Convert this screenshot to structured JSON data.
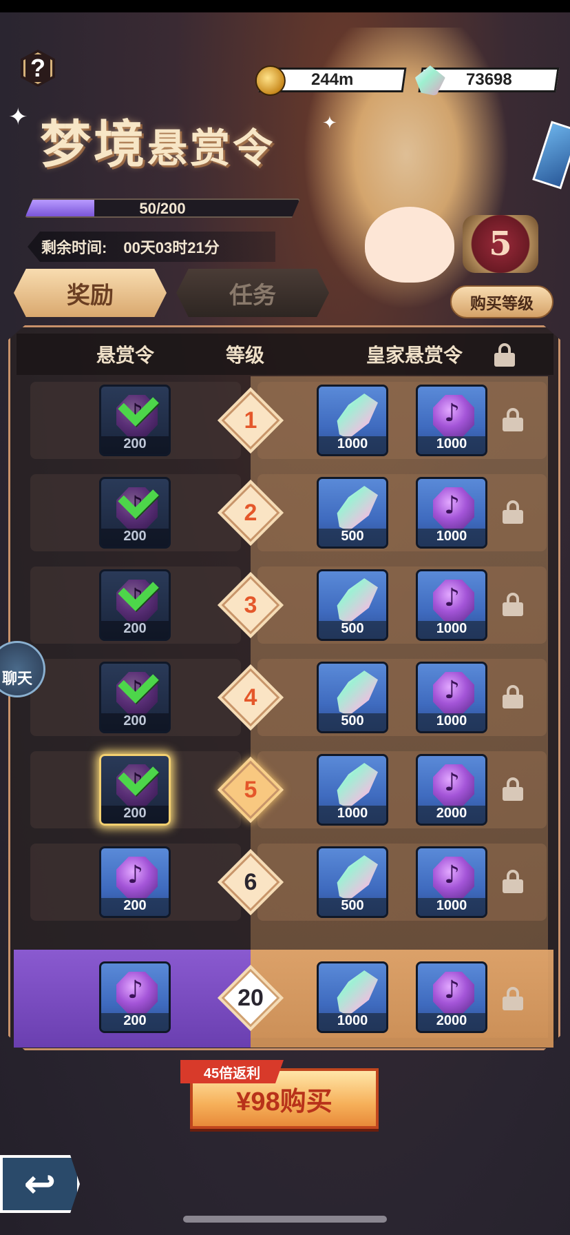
{
  "header": {
    "help_label": "?",
    "title_main": "梦境",
    "title_sub": "悬赏令",
    "coins": "244m",
    "feathers": "73698",
    "progress_text": "50/200",
    "progress_fraction": 0.25,
    "timer_label": "剩余时间:",
    "timer_value": "00天03时21分",
    "current_level": "5",
    "buy_level_label": "购买等级"
  },
  "tabs": [
    {
      "label": "奖励",
      "active": true
    },
    {
      "label": "任务",
      "active": false
    }
  ],
  "table": {
    "col_normal": "悬赏令",
    "col_level": "等级",
    "col_royal": "皇家悬赏令",
    "rows": [
      {
        "level": "1",
        "normal_qty": "200",
        "claimed": true,
        "royal1_qty": "1000",
        "royal2_qty": "1000"
      },
      {
        "level": "2",
        "normal_qty": "200",
        "claimed": true,
        "royal1_qty": "500",
        "royal2_qty": "1000"
      },
      {
        "level": "3",
        "normal_qty": "200",
        "claimed": true,
        "royal1_qty": "500",
        "royal2_qty": "1000"
      },
      {
        "level": "4",
        "normal_qty": "200",
        "claimed": true,
        "royal1_qty": "500",
        "royal2_qty": "1000"
      },
      {
        "level": "5",
        "normal_qty": "200",
        "claimed": true,
        "royal1_qty": "1000",
        "royal2_qty": "2000"
      },
      {
        "level": "6",
        "normal_qty": "200",
        "claimed": false,
        "royal1_qty": "500",
        "royal2_qty": "1000"
      }
    ],
    "final_row": {
      "level": "20",
      "normal_qty": "200",
      "royal1_qty": "1000",
      "royal2_qty": "2000"
    }
  },
  "chat_label": "聊天",
  "promo": {
    "tag": "45倍返利",
    "buy_label": "¥98购买"
  },
  "icons": {
    "normal_reward": "purple-coin-icon",
    "royal_reward_1": "feather-icon",
    "royal_reward_2": "purple-coin-icon",
    "lock": "lock-icon",
    "back": "back-arrow-icon"
  }
}
